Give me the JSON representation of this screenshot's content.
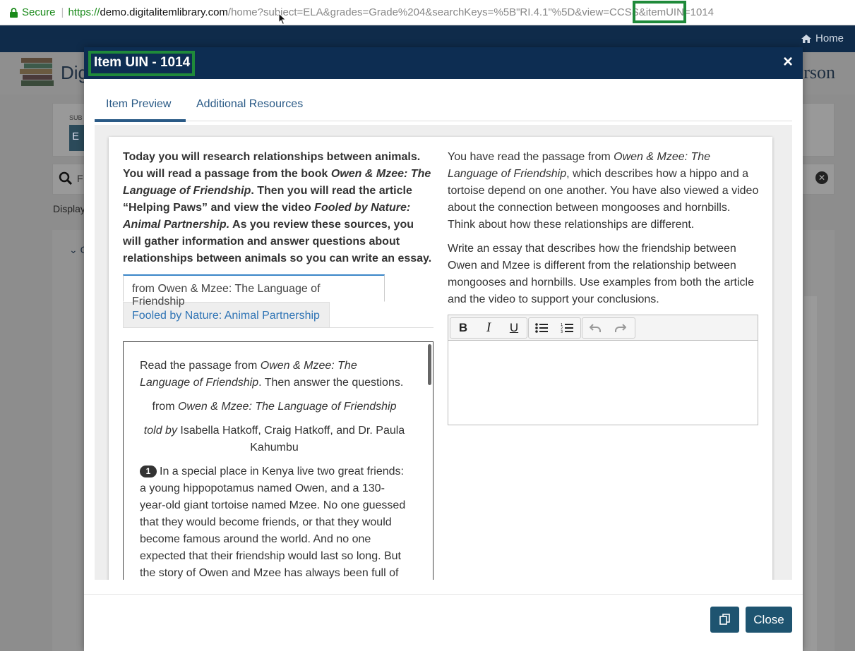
{
  "browser": {
    "secure_label": "Secure",
    "url_scheme": "https://",
    "url_host": "demo.digitalitemlibrary.com",
    "url_path": "/home?subject=ELA&grades=Grade%204&searchKeys=%5B\"RI.4.1\"%5D&view=CCSS&itemUIN=1014"
  },
  "site": {
    "nav_home": "Home",
    "title_partial": "Dig",
    "brand_partial": "rson",
    "subject_label": "SUB",
    "subject_button_partial": "E",
    "search_partial": "F",
    "display_partial": "Display",
    "list_toggle_partial": "C"
  },
  "modal": {
    "title": "Item UIN - 1014",
    "close_x": "×",
    "tabs": [
      {
        "label": "Item Preview",
        "active": true
      },
      {
        "label": "Additional Resources",
        "active": false
      }
    ],
    "intro": {
      "part1": "Today you will research relationships between animals. You will read a passage from the book ",
      "book": "Owen & Mzee: The Language of Friendship",
      "part2": ". Then you will read the article “Helping Paws” and view the video ",
      "video": "Fooled by Nature: Animal Partnership.",
      "part3": " As you review these sources, you will gather information and answer questions about relationships between animals so you can write an essay."
    },
    "passage_tabs": [
      {
        "label": "from Owen & Mzee: The Language of Friendship"
      },
      {
        "label": "Fooled by Nature: Animal Partnership"
      }
    ],
    "passage": {
      "instr_pre": "Read the passage from ",
      "instr_title": "Owen & Mzee: The Language of Friendship",
      "instr_post": ". Then answer the questions.",
      "heading_pre": "from ",
      "heading_title": "Owen & Mzee: The Language of Friendship",
      "byline_pre": "told by",
      "byline_authors": " Isabella Hatkoff, Craig Hatkoff, and Dr. Paula Kahumbu",
      "para_number": "1",
      "para_text": "In a special place in Kenya live two great friends: a young hippopotamus named Owen, and a 130-year-old giant tortoise named Mzee. No one guessed that they would become friends, or that they would become famous around the world. And no one expected that their friendship would last so long. But the story of Owen and Mzee has always been full of surprises."
    },
    "prompt": {
      "p1_pre": "You have read the passage from ",
      "p1_title": "Owen & Mzee: The Language of Friendship",
      "p1_post": ", which describes how a hippo and a tortoise depend on one another. You have also viewed a video about the connection between mongooses and hornbills. Think about how these relationships are different.",
      "p2": "Write an essay that describes how the friendship between Owen and Mzee is different from the relationship between mongooses and hornbills. Use examples from both the article and the video to support your conclusions."
    },
    "editor": {
      "bold": "B",
      "italic": "I",
      "underline": "U",
      "value": ""
    },
    "footer": {
      "close_label": "Close"
    }
  },
  "colors": {
    "modal_header": "#0d2d52",
    "highlight": "#1f8a3a",
    "primary_button": "#1e5470",
    "link": "#2a5a86"
  },
  "icons": [
    "lock-icon",
    "home-icon",
    "close-icon",
    "search-icon",
    "bulleted-list-icon",
    "numbered-list-icon",
    "undo-icon",
    "redo-icon",
    "copy-icon"
  ]
}
